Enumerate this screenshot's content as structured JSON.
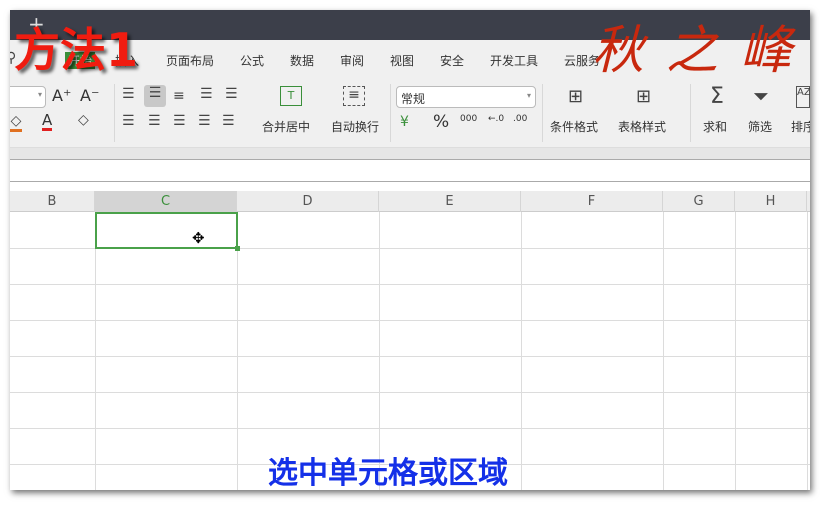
{
  "overlay": {
    "title": "方法1",
    "signature": "秋之峰",
    "caption": "选中单元格或区域"
  },
  "titlebar": {
    "new_tab": "+"
  },
  "tabs": [
    "开始",
    "插入",
    "页面布局",
    "公式",
    "数据",
    "审阅",
    "视图",
    "安全",
    "开发工具",
    "云服务"
  ],
  "ribbon": {
    "font_grow": "A⁺",
    "font_shrink": "A⁻",
    "font_color": "A",
    "merge_center": "合并居中",
    "wrap_text": "自动换行",
    "number_format": "常规",
    "percent": "%",
    "thousands": "000",
    "inc_decimal": "←.0",
    "dec_decimal": ".00",
    "cond_format": "条件格式",
    "table_style": "表格样式",
    "sum": "求和",
    "filter": "筛选",
    "sort": "排序"
  },
  "columns": [
    "B",
    "C",
    "D",
    "E",
    "F",
    "G",
    "H"
  ],
  "selected_cell": "C1",
  "accent": "#4aa14a"
}
